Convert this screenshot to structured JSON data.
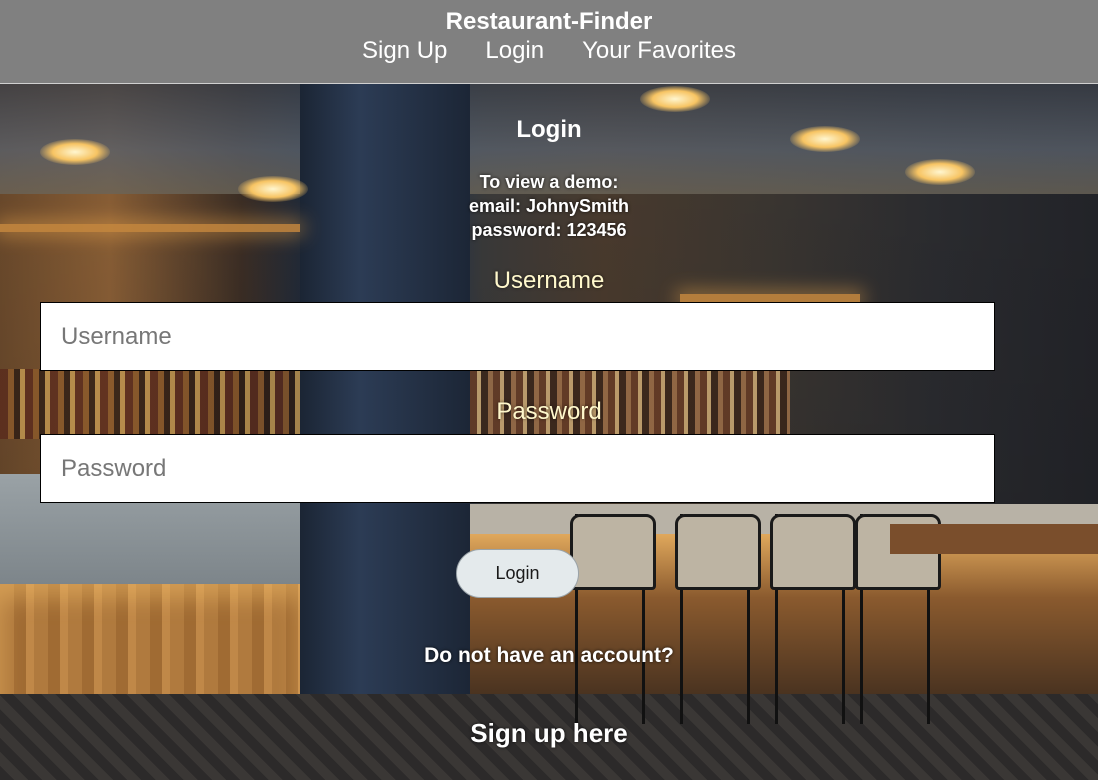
{
  "header": {
    "brand": "Restaurant-Finder",
    "nav": [
      {
        "label": "Sign Up"
      },
      {
        "label": "Login"
      },
      {
        "label": "Your Favorites"
      }
    ],
    "background_color": "#808080"
  },
  "login": {
    "title": "Login",
    "demo_lines": [
      "To view a demo:",
      "email: JohnySmith",
      "password: 123456"
    ],
    "username_label": "Username",
    "username_placeholder": "Username",
    "password_label": "Password",
    "password_placeholder": "Password",
    "submit_label": "Login",
    "no_account_text": "Do not have an account?",
    "signup_link": "Sign up here",
    "label_color": "#fff8cc"
  },
  "background": {
    "image": "restaurant-bar-photo"
  }
}
